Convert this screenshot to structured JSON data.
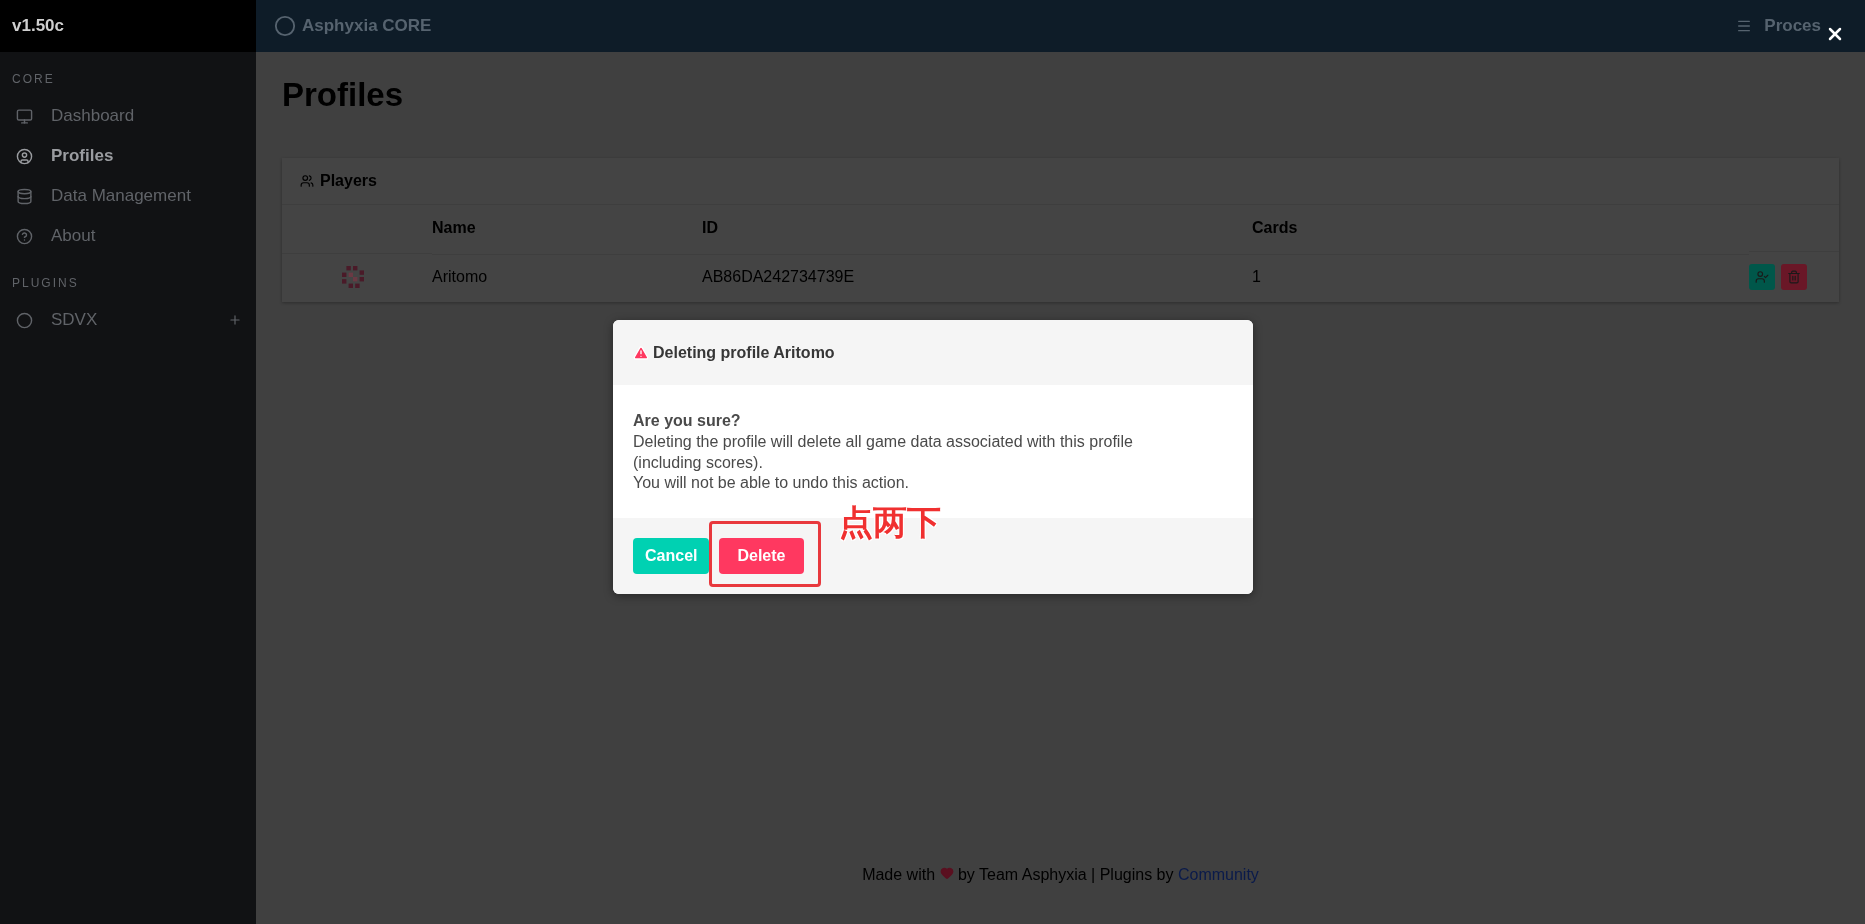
{
  "sidebar": {
    "version": "v1.50c",
    "sections": [
      {
        "title": "CORE",
        "items": [
          {
            "label": "Dashboard",
            "selected": false,
            "expandable": false
          },
          {
            "label": "Profiles",
            "selected": true,
            "expandable": false
          },
          {
            "label": "Data Management",
            "selected": false,
            "expandable": false
          },
          {
            "label": "About",
            "selected": false,
            "expandable": false
          }
        ]
      },
      {
        "title": "PLUGINS",
        "items": [
          {
            "label": "SDVX",
            "selected": false,
            "expandable": true
          }
        ]
      }
    ]
  },
  "header": {
    "brand": "Asphyxia CORE",
    "menu": "Proces"
  },
  "page": {
    "title": "Profiles",
    "card": {
      "title": "Players",
      "columns": [
        "Name",
        "ID",
        "Cards"
      ],
      "rows": [
        {
          "name": "Aritomo",
          "id": "AB86DA242734739E",
          "cards": "1"
        }
      ]
    }
  },
  "footer": {
    "before": "Made with",
    "after": "by Team Asphyxia | Plugins by",
    "link": "Community"
  },
  "modal": {
    "title": "Deleting profile Aritomo",
    "question": "Are you sure?",
    "lines": [
      "Deleting the profile will delete all game data associated with this profile",
      "(including scores).",
      "You will not be able to undo this action."
    ],
    "buttons": [
      {
        "label": "Cancel",
        "kind": "cancel"
      },
      {
        "label": "Delete",
        "kind": "danger"
      }
    ],
    "annotation": "点两下"
  }
}
